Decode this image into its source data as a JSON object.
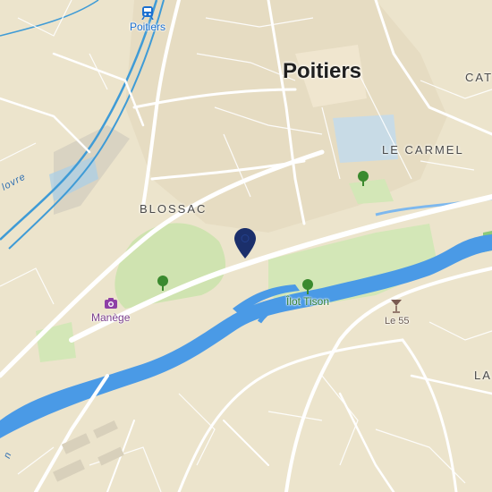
{
  "map": {
    "city_label": "Poitiers",
    "districts": {
      "blossac": "BLOSSAC",
      "le_carmel": "LE CARMEL",
      "cat_partial": "CAT",
      "la_partial": "LA"
    },
    "pois": {
      "station": "Poitiers",
      "manege": "Manège",
      "ilot_tison": "Îlot Tison",
      "le_55": "Le 55"
    },
    "water_labels": {
      "clain_partial": "lovre",
      "bottom_left_partial": "n"
    },
    "icons": {
      "station": "train-station-icon",
      "manege": "camera-icon",
      "park": "tree-icon",
      "bar": "cocktail-glass-icon",
      "pin": "location-pin-icon"
    },
    "colors": {
      "land": "#ece4cc",
      "water": "#4a9ae6",
      "park": "#cfe3b0",
      "road": "#ffffff",
      "pin": "#1b2f6b",
      "rail": "#3f9bd6"
    }
  }
}
